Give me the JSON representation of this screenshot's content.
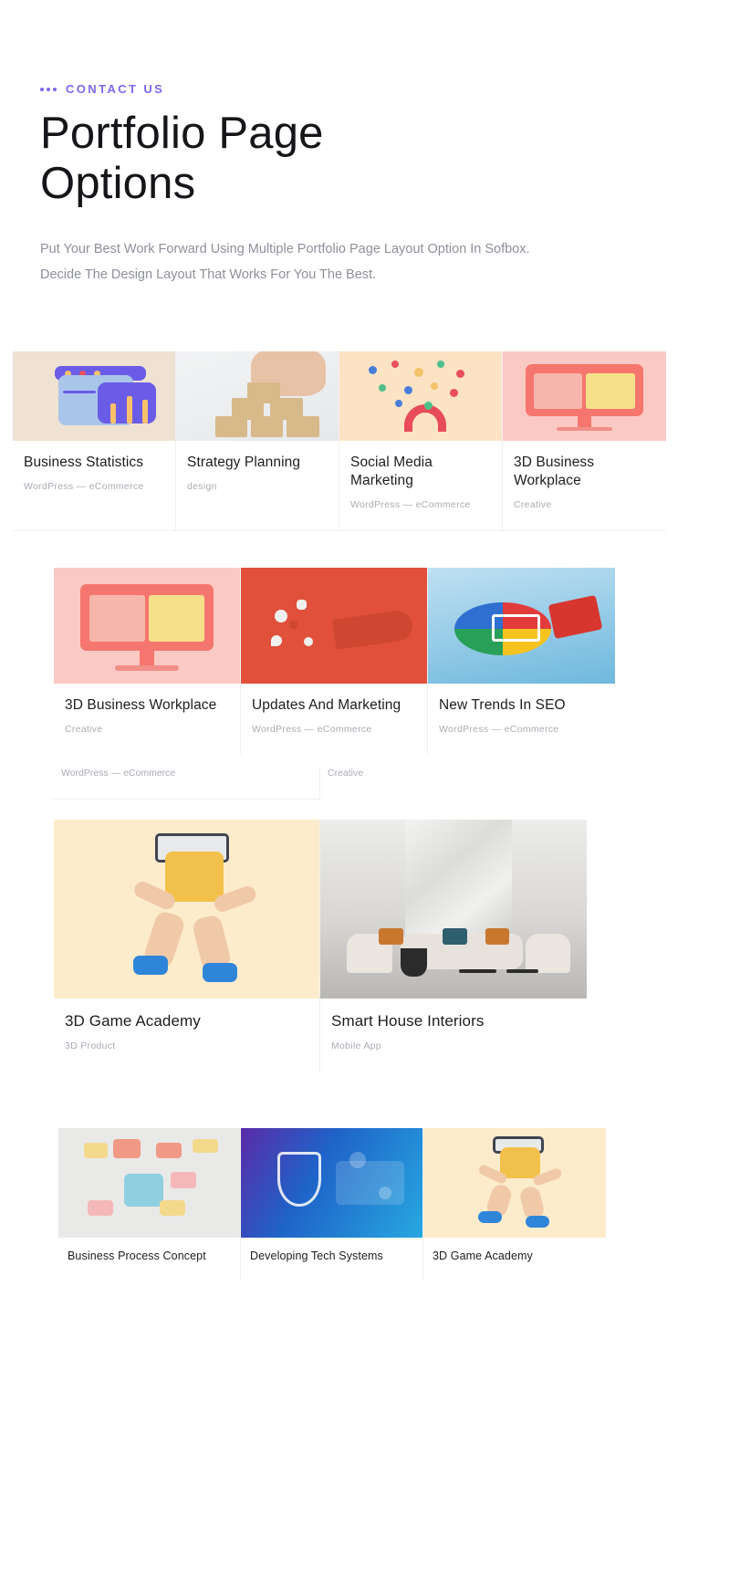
{
  "header": {
    "eyebrow": "CONTACT US",
    "title": "Portfolio Page Options",
    "subtitle": "Put Your Best Work Forward Using Multiple Portfolio Page Layout Option In Sofbox. Decide The Design Layout That Works For You The Best.",
    "accent_color": "#7b68ee",
    "title_color": "#16161a",
    "subtitle_color": "#8d9099"
  },
  "portfolio": {
    "row1": [
      {
        "title": "Business Statistics",
        "category": "WordPress — eCommerce",
        "art": "t-stats"
      },
      {
        "title": "Strategy Planning",
        "category": "design",
        "art": "t-blocks"
      },
      {
        "title": "Social Media Marketing",
        "category": "WordPress — eCommerce",
        "art": "t-social"
      },
      {
        "title": "3D Business Workplace",
        "category": "Creative",
        "art": "t-pinkmon"
      }
    ],
    "row2": [
      {
        "title": "3D Business Workplace",
        "category": "Creative",
        "art": "t-pinkmon"
      },
      {
        "title": "Updates And Marketing",
        "category": "WordPress — eCommerce",
        "art": "t-mega"
      },
      {
        "title": "New Trends In SEO",
        "category": "WordPress — eCommerce",
        "art": "t-seo"
      }
    ],
    "orphan_labels": [
      {
        "category": "WordPress — eCommerce"
      },
      {
        "category": "Creative"
      }
    ],
    "row3": [
      {
        "title": "3D Game Academy",
        "category": "3D Product",
        "art": "t-game"
      },
      {
        "title": "Smart House Interiors",
        "category": "Mobile App",
        "art": "t-interior"
      }
    ],
    "row4": [
      {
        "title": "Business Process Concept",
        "category": "",
        "art": "t-process"
      },
      {
        "title": "Developing Tech Systems",
        "category": "",
        "art": "t-tech"
      },
      {
        "title": "3D Game Academy",
        "category": "",
        "art": "t-game"
      }
    ]
  }
}
